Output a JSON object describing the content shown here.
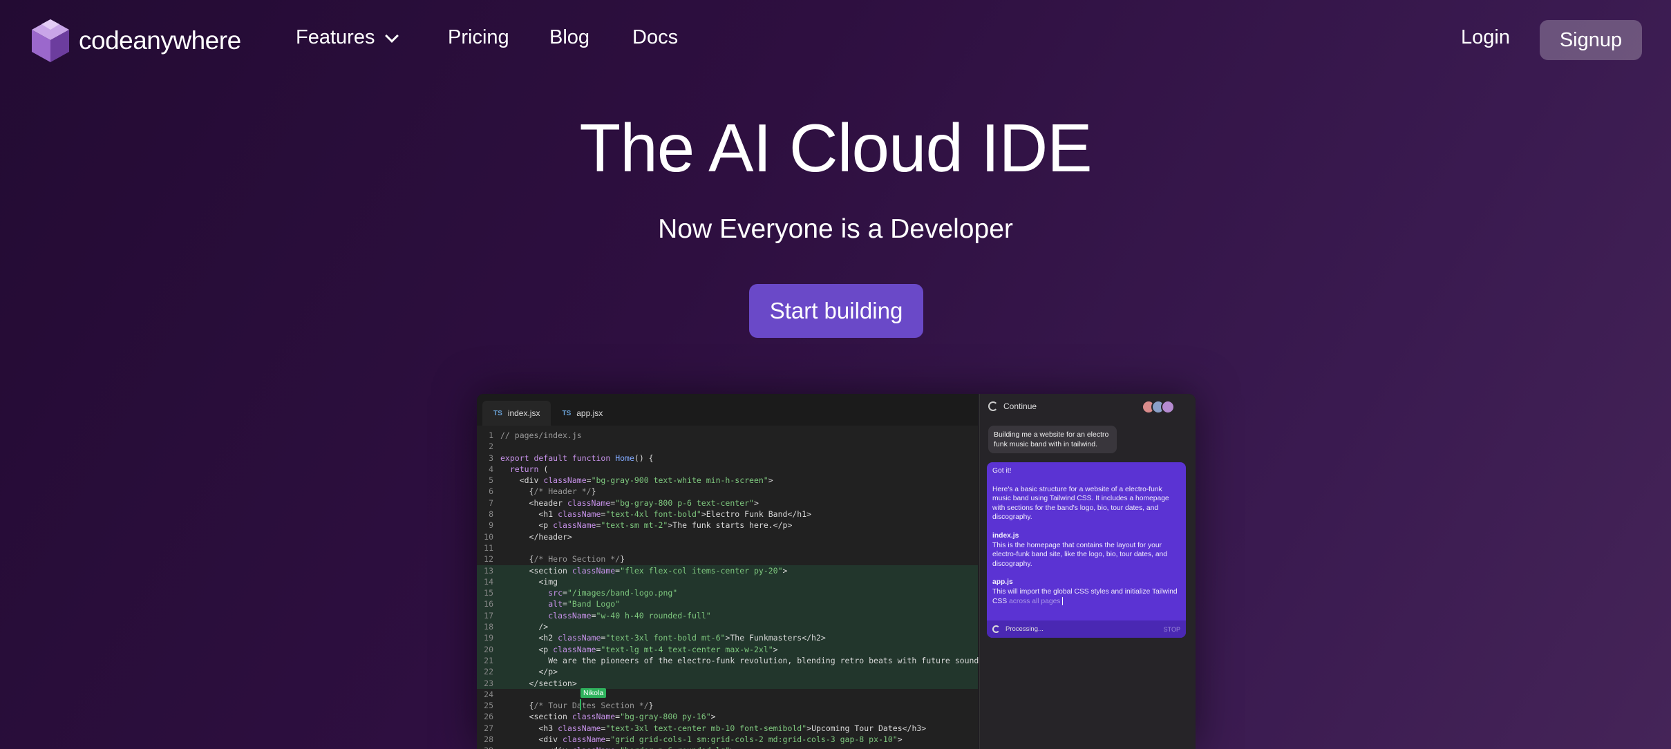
{
  "nav": {
    "brand": "codeanywhere",
    "features": "Features",
    "pricing": "Pricing",
    "blog": "Blog",
    "docs": "Docs",
    "login": "Login",
    "signup": "Signup"
  },
  "hero": {
    "title": "The AI Cloud IDE",
    "subtitle": "Now Everyone is a Developer",
    "cta": "Start building"
  },
  "editor": {
    "tabs": [
      {
        "lang": "TS",
        "name": "index.jsx"
      },
      {
        "lang": "TS",
        "name": "app.jsx"
      }
    ],
    "cursor_user": "Nikola"
  },
  "chat": {
    "header": "Continue",
    "user_message": "Building me a website for an electro funk music band with in tailwind.",
    "ai": {
      "greeting": "Got it!",
      "intro": "Here's a basic structure for a website of a electro-funk music band using Tailwind CSS. It includes a homepage with sections for the band's logo, bio, tour dates, and discography.",
      "file1_name": "index.js",
      "file1_desc": "This is the homepage that contains the layout for your electro-funk band site, like the logo, bio, tour dates, and discography.",
      "file2_name": "app.js",
      "file2_desc_a": "This will import the global CSS styles and initialize Tailwind CSS",
      "file2_desc_b": " across all pages",
      "status": "Processing...",
      "stop": "STOP"
    }
  },
  "colors": {
    "cta": "#6a49c8",
    "ai_message": "#5b33d3",
    "cursor": "#2fb25d"
  }
}
